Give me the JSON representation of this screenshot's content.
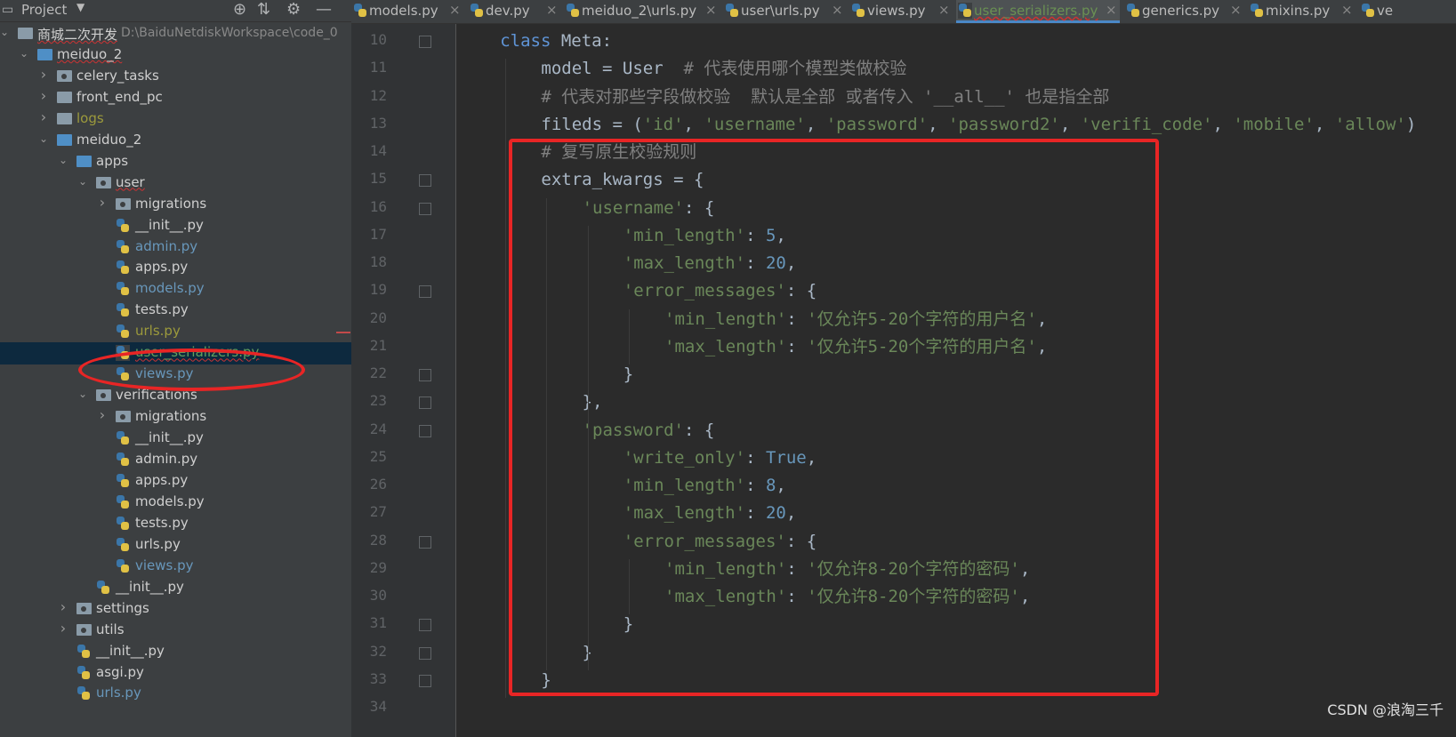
{
  "panel": {
    "title": "Project"
  },
  "tree": [
    {
      "label": "商城二次开发",
      "path": "D:\\BaiduNetdiskWorkspace\\code_0",
      "indent": 0,
      "arrow": "open",
      "icon": "folder",
      "color": "",
      "squiggle": true
    },
    {
      "label": "meiduo_2",
      "indent": 1,
      "arrow": "open",
      "icon": "folder-blue",
      "color": "",
      "squiggle": true
    },
    {
      "label": "celery_tasks",
      "indent": 2,
      "arrow": "closed",
      "icon": "folder-pkg",
      "color": ""
    },
    {
      "label": "front_end_pc",
      "indent": 2,
      "arrow": "closed",
      "icon": "folder",
      "color": ""
    },
    {
      "label": "logs",
      "indent": 2,
      "arrow": "closed",
      "icon": "folder",
      "color": "olive"
    },
    {
      "label": "meiduo_2",
      "indent": 2,
      "arrow": "open",
      "icon": "folder-blue",
      "color": ""
    },
    {
      "label": "apps",
      "indent": 3,
      "arrow": "open",
      "icon": "folder-blue",
      "color": ""
    },
    {
      "label": "user",
      "indent": 4,
      "arrow": "open",
      "icon": "folder-pkg",
      "color": "",
      "squiggle": true
    },
    {
      "label": "migrations",
      "indent": 5,
      "arrow": "closed",
      "icon": "folder-pkg",
      "color": ""
    },
    {
      "label": "__init__.py",
      "indent": 5,
      "arrow": "",
      "icon": "py",
      "color": ""
    },
    {
      "label": "admin.py",
      "indent": 5,
      "arrow": "",
      "icon": "py",
      "color": "mod"
    },
    {
      "label": "apps.py",
      "indent": 5,
      "arrow": "",
      "icon": "py",
      "color": ""
    },
    {
      "label": "models.py",
      "indent": 5,
      "arrow": "",
      "icon": "py",
      "color": "mod"
    },
    {
      "label": "tests.py",
      "indent": 5,
      "arrow": "",
      "icon": "py",
      "color": ""
    },
    {
      "label": "urls.py",
      "indent": 5,
      "arrow": "",
      "icon": "py",
      "color": "olive"
    },
    {
      "label": "user_serializers.py",
      "indent": 5,
      "arrow": "",
      "icon": "py",
      "color": "green",
      "selected": true,
      "squiggle": true
    },
    {
      "label": "views.py",
      "indent": 5,
      "arrow": "",
      "icon": "py",
      "color": "mod"
    },
    {
      "label": "verifications",
      "indent": 4,
      "arrow": "open",
      "icon": "folder-pkg",
      "color": ""
    },
    {
      "label": "migrations",
      "indent": 5,
      "arrow": "closed",
      "icon": "folder-pkg",
      "color": ""
    },
    {
      "label": "__init__.py",
      "indent": 5,
      "arrow": "",
      "icon": "py",
      "color": ""
    },
    {
      "label": "admin.py",
      "indent": 5,
      "arrow": "",
      "icon": "py",
      "color": ""
    },
    {
      "label": "apps.py",
      "indent": 5,
      "arrow": "",
      "icon": "py",
      "color": ""
    },
    {
      "label": "models.py",
      "indent": 5,
      "arrow": "",
      "icon": "py",
      "color": ""
    },
    {
      "label": "tests.py",
      "indent": 5,
      "arrow": "",
      "icon": "py",
      "color": ""
    },
    {
      "label": "urls.py",
      "indent": 5,
      "arrow": "",
      "icon": "py",
      "color": ""
    },
    {
      "label": "views.py",
      "indent": 5,
      "arrow": "",
      "icon": "py",
      "color": "mod"
    },
    {
      "label": "__init__.py",
      "indent": 4,
      "arrow": "",
      "icon": "py",
      "color": ""
    },
    {
      "label": "settings",
      "indent": 3,
      "arrow": "closed",
      "icon": "folder-pkg",
      "color": ""
    },
    {
      "label": "utils",
      "indent": 3,
      "arrow": "closed",
      "icon": "folder-pkg",
      "color": ""
    },
    {
      "label": "__init__.py",
      "indent": 3,
      "arrow": "",
      "icon": "py",
      "color": ""
    },
    {
      "label": "asgi.py",
      "indent": 3,
      "arrow": "",
      "icon": "py",
      "color": ""
    },
    {
      "label": "urls.py",
      "indent": 3,
      "arrow": "",
      "icon": "py",
      "color": "mod"
    }
  ],
  "tabs": [
    {
      "label": "models.py",
      "active": false
    },
    {
      "label": "dev.py",
      "active": false
    },
    {
      "label": "meiduo_2\\urls.py",
      "active": false
    },
    {
      "label": "user\\urls.py",
      "active": false
    },
    {
      "label": "views.py",
      "active": false
    },
    {
      "label": "user_serializers.py",
      "active": true
    },
    {
      "label": "generics.py",
      "active": false
    },
    {
      "label": "mixins.py",
      "active": false
    },
    {
      "label": "ve",
      "active": false,
      "noclose": true
    }
  ],
  "code": [
    {
      "n": "10",
      "indent": 1,
      "t": [
        [
          "kw",
          "class "
        ],
        [
          "",
          "Meta:"
        ]
      ]
    },
    {
      "n": "11",
      "indent": 2,
      "t": [
        [
          "",
          "model = User  "
        ],
        [
          "cmt",
          "# 代表使用哪个模型类做校验"
        ]
      ]
    },
    {
      "n": "12",
      "indent": 2,
      "t": [
        [
          "cmt",
          "# 代表对那些字段做校验  默认是全部 或者传入 '__all__' 也是指全部"
        ]
      ]
    },
    {
      "n": "13",
      "indent": 2,
      "t": [
        [
          "",
          "fileds = ("
        ],
        [
          "str",
          "'id'"
        ],
        [
          "",
          ", "
        ],
        [
          "str",
          "'username'"
        ],
        [
          "",
          ", "
        ],
        [
          "str",
          "'password'"
        ],
        [
          "",
          ", "
        ],
        [
          "str",
          "'password2'"
        ],
        [
          "",
          ", "
        ],
        [
          "str",
          "'verifi_code'"
        ],
        [
          "",
          ", "
        ],
        [
          "str",
          "'mobile'"
        ],
        [
          "",
          ", "
        ],
        [
          "str",
          "'allow'"
        ],
        [
          "",
          ")"
        ]
      ]
    },
    {
      "n": "14",
      "indent": 2,
      "t": [
        [
          "cmt",
          "# 复写原生校验规则"
        ]
      ]
    },
    {
      "n": "15",
      "indent": 2,
      "t": [
        [
          "",
          "extra_kwargs = {"
        ]
      ]
    },
    {
      "n": "16",
      "indent": 3,
      "t": [
        [
          "str",
          "'username'"
        ],
        [
          "",
          ": {"
        ]
      ]
    },
    {
      "n": "17",
      "indent": 4,
      "t": [
        [
          "str",
          "'min_length'"
        ],
        [
          "",
          ": "
        ],
        [
          "num",
          "5"
        ],
        [
          "",
          ","
        ]
      ]
    },
    {
      "n": "18",
      "indent": 4,
      "t": [
        [
          "str",
          "'max_length'"
        ],
        [
          "",
          ": "
        ],
        [
          "num",
          "20"
        ],
        [
          "",
          ","
        ]
      ]
    },
    {
      "n": "19",
      "indent": 4,
      "t": [
        [
          "str",
          "'error_messages'"
        ],
        [
          "",
          ": {"
        ]
      ]
    },
    {
      "n": "20",
      "indent": 5,
      "t": [
        [
          "str",
          "'min_length'"
        ],
        [
          "",
          ": "
        ],
        [
          "str",
          "'仅允许5-20个字符的用户名'"
        ],
        [
          "",
          ","
        ]
      ]
    },
    {
      "n": "21",
      "indent": 5,
      "t": [
        [
          "str",
          "'max_length'"
        ],
        [
          "",
          ": "
        ],
        [
          "str",
          "'仅允许5-20个字符的用户名'"
        ],
        [
          "",
          ","
        ]
      ]
    },
    {
      "n": "22",
      "indent": 4,
      "t": [
        [
          "",
          "}"
        ]
      ]
    },
    {
      "n": "23",
      "indent": 3,
      "t": [
        [
          "",
          "},"
        ]
      ]
    },
    {
      "n": "24",
      "indent": 3,
      "t": [
        [
          "str",
          "'password'"
        ],
        [
          "",
          ": {"
        ]
      ]
    },
    {
      "n": "25",
      "indent": 4,
      "t": [
        [
          "str",
          "'write_only'"
        ],
        [
          "",
          ": "
        ],
        [
          "lit",
          "True"
        ],
        [
          "",
          ","
        ]
      ]
    },
    {
      "n": "26",
      "indent": 4,
      "t": [
        [
          "str",
          "'min_length'"
        ],
        [
          "",
          ": "
        ],
        [
          "num",
          "8"
        ],
        [
          "",
          ","
        ]
      ]
    },
    {
      "n": "27",
      "indent": 4,
      "t": [
        [
          "str",
          "'max_length'"
        ],
        [
          "",
          ": "
        ],
        [
          "num",
          "20"
        ],
        [
          "",
          ","
        ]
      ]
    },
    {
      "n": "28",
      "indent": 4,
      "t": [
        [
          "str",
          "'error_messages'"
        ],
        [
          "",
          ": {"
        ]
      ]
    },
    {
      "n": "29",
      "indent": 5,
      "t": [
        [
          "str",
          "'min_length'"
        ],
        [
          "",
          ": "
        ],
        [
          "str",
          "'仅允许8-20个字符的密码'"
        ],
        [
          "",
          ","
        ]
      ]
    },
    {
      "n": "30",
      "indent": 5,
      "t": [
        [
          "str",
          "'max_length'"
        ],
        [
          "",
          ": "
        ],
        [
          "str",
          "'仅允许8-20个字符的密码'"
        ],
        [
          "",
          ","
        ]
      ]
    },
    {
      "n": "31",
      "indent": 4,
      "t": [
        [
          "",
          "}"
        ]
      ]
    },
    {
      "n": "32",
      "indent": 3,
      "t": [
        [
          "",
          "}"
        ]
      ]
    },
    {
      "n": "33",
      "indent": 2,
      "t": [
        [
          "",
          "}"
        ]
      ]
    },
    {
      "n": "34",
      "indent": 0,
      "t": []
    }
  ],
  "folds": [
    "10",
    "15",
    "16",
    "19",
    "22",
    "23",
    "24",
    "28",
    "31",
    "32",
    "33"
  ],
  "watermark": "CSDN @浪淘三千"
}
